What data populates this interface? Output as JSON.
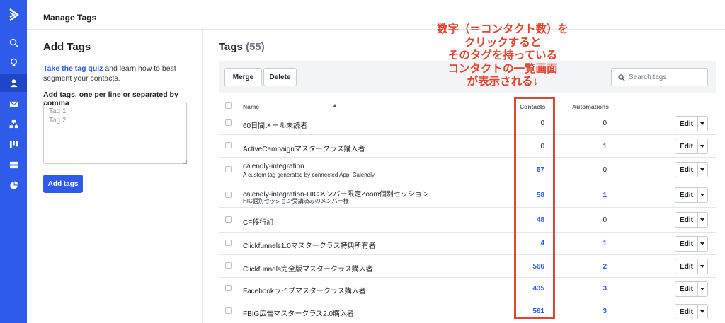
{
  "header": {
    "title": "Manage Tags"
  },
  "left_panel": {
    "title": "Add Tags",
    "quiz_link": "Take the tag quiz",
    "quiz_text": " and learn how to best segment your contacts.",
    "input_label": "Add tags, one per line or separated by comma",
    "textarea_placeholder": "Tag 1\nTag 2",
    "add_button": "Add tags"
  },
  "main": {
    "title": "Tags",
    "count": "(55)",
    "merge_button": "Merge",
    "delete_button": "Delete",
    "search_placeholder": "Search tags",
    "columns": {
      "name": "Name",
      "contacts": "Contacts",
      "automations": "Automations"
    },
    "edit_label": "Edit",
    "rows": [
      {
        "name": "60日間メール未読者",
        "description": "",
        "contacts": "0",
        "automations": "0"
      },
      {
        "name": "ActiveCampaignマスタークラス購入者",
        "description": "",
        "contacts": "0",
        "automations": "1"
      },
      {
        "name": "calendly-integration",
        "description": "A custom tag generated by connected App: Calendly",
        "contacts": "57",
        "automations": "0"
      },
      {
        "name": "calendly-integration-HICメンバー限定Zoom個別セッション",
        "description": "HIC個別セッション受講済みのメンバー様",
        "contacts": "58",
        "automations": "1"
      },
      {
        "name": "CF移行組",
        "description": "",
        "contacts": "48",
        "automations": "0"
      },
      {
        "name": "Clickfunnels1.0マスタークラス特典所有者",
        "description": "",
        "contacts": "4",
        "automations": "1"
      },
      {
        "name": "Clickfunnels完全版マスタークラス購入者",
        "description": "",
        "contacts": "566",
        "automations": "2"
      },
      {
        "name": "Facebookライブマスタークラス購入者",
        "description": "",
        "contacts": "435",
        "automations": "3"
      },
      {
        "name": "FBIG広告マスタークラス2.0購入者",
        "description": "",
        "contacts": "561",
        "automations": "3"
      }
    ]
  },
  "annotation": {
    "lines": [
      "数字（＝コンタクト数）を",
      "クリックすると",
      "そのタグを持っている",
      "コンタクトの一覧画面",
      "が表示される↓"
    ],
    "color": "#e0452f"
  },
  "colors": {
    "brand": "#2f5bea",
    "link": "#2f5bea"
  },
  "sidebar_icons": [
    "logo-chevron-icon",
    "search-icon",
    "lightbulb-icon",
    "contacts-icon",
    "envelope-icon",
    "automation-icon",
    "pipeline-icon",
    "list-icon",
    "reports-pie-icon"
  ]
}
